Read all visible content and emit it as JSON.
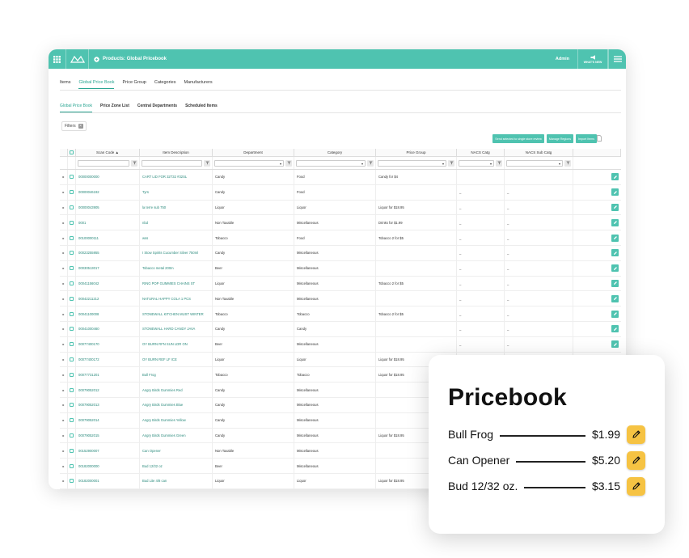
{
  "topbar": {
    "title": "Products: Global Pricebook",
    "admin": "Admin",
    "whatsnew": "WHAT'S NEW"
  },
  "tabs_primary": [
    "Items",
    "Global Price Book",
    "Price Group",
    "Categories",
    "Manufacturers"
  ],
  "tabs_secondary": [
    "Global Price Book",
    "Price Zone List",
    "Central Departments",
    "Scheduled Items"
  ],
  "filters_label": "Filters",
  "actions": [
    "Send selected to single store review",
    "Manage Regions",
    "Import Items"
  ],
  "columns": [
    "Scan Code",
    "Item Description",
    "Department",
    "Category",
    "Price Group",
    "NACS Catg",
    "NACS Sub Catg"
  ],
  "rows": [
    {
      "scan": "00000000000",
      "desc": "CART LID FOR 32T32 #32SL",
      "dept": "Candy",
      "cat": "Food",
      "pg": "Candy for $4",
      "nacs": "",
      "sub": ""
    },
    {
      "scan": "00000046192",
      "desc": "Tyrs",
      "dept": "Candy",
      "cat": "Food",
      "pg": "",
      "nacs": "_",
      "sub": "_"
    },
    {
      "scan": "00000043905",
      "desc": "la terre sub 750",
      "dept": "Liquor",
      "cat": "Liquor",
      "pg": "Liquor for $18.95",
      "nacs": "_",
      "sub": "_"
    },
    {
      "scan": "0001",
      "desc": "nbd",
      "dept": "Non Taxable",
      "cat": "Miscellaneous",
      "pg": "Drinks for $1.99",
      "nacs": "_",
      "sub": "_"
    },
    {
      "scan": "00100000111",
      "desc": "wss",
      "dept": "Tobacco",
      "cat": "Food",
      "pg": "Tobacco 2 for $5",
      "nacs": "_",
      "sub": "_"
    },
    {
      "scan": "00023255955",
      "desc": "I Stow Spirits Cucumber Silver 750ml",
      "dept": "Candy",
      "cat": "Miscellaneous",
      "pg": "",
      "nacs": "_",
      "sub": "_"
    },
    {
      "scan": "00030513017",
      "desc": "Tobacco metal 200m",
      "dept": "Beer",
      "cat": "Miscellaneous",
      "pg": "",
      "nacs": "_",
      "sub": "_"
    },
    {
      "scan": "00041156042",
      "desc": "RING POP GUMMIES CHAINS ST",
      "dept": "Liquor",
      "cat": "Miscellaneous",
      "pg": "Tobacco 2 for $5",
      "nacs": "_",
      "sub": "_"
    },
    {
      "scan": "00042211212",
      "desc": "NATURAL HAPPY COLA 1 PCS",
      "dept": "Non Taxable",
      "cat": "Miscellaneous",
      "pg": "",
      "nacs": "_",
      "sub": "_"
    },
    {
      "scan": "00041100008",
      "desc": "STONEWALL KITCHEN MUST WINTER",
      "dept": "Tobacco",
      "cat": "Tobacco",
      "pg": "Tobacco 2 for $5",
      "nacs": "_",
      "sub": "_"
    },
    {
      "scan": "00041000460",
      "desc": "STONEWALL HARD CANDY JAVA",
      "dept": "Candy",
      "cat": "Candy",
      "pg": "",
      "nacs": "_",
      "sub": "_"
    },
    {
      "scan": "00077400170",
      "desc": "OY BURN RFN SUN LDR ON",
      "dept": "Beer",
      "cat": "Miscellaneous",
      "pg": "",
      "nacs": "_",
      "sub": "_"
    },
    {
      "scan": "00077400172",
      "desc": "OY BURN REF LF ICE",
      "dept": "Liquor",
      "cat": "Liquor",
      "pg": "Liquor for $18.95",
      "nacs": "_",
      "sub": "_"
    },
    {
      "scan": "00077731201",
      "desc": "Bull Frog",
      "dept": "Tobacco",
      "cat": "Tobacco",
      "pg": "Liquor for $18.95",
      "nacs": "_",
      "sub": "_"
    },
    {
      "scan": "00079052012",
      "desc": "Angry Birds Gummies Red",
      "dept": "Candy",
      "cat": "Miscellaneous",
      "pg": "",
      "nacs": "_",
      "sub": "_"
    },
    {
      "scan": "00079052013",
      "desc": "Angry Birds Gummies Blue",
      "dept": "Candy",
      "cat": "Miscellaneous",
      "pg": "",
      "nacs": "_",
      "sub": "_"
    },
    {
      "scan": "00079052014",
      "desc": "Angry Birds Gummies Yellow",
      "dept": "Candy",
      "cat": "Miscellaneous",
      "pg": "",
      "nacs": "_",
      "sub": "_"
    },
    {
      "scan": "00079052015",
      "desc": "Angry Birds Gummies Green",
      "dept": "Candy",
      "cat": "Miscellaneous",
      "pg": "Liquor for $18.95",
      "nacs": "_",
      "sub": "_"
    },
    {
      "scan": "00152900007",
      "desc": "Can Opener",
      "dept": "Non Taxable",
      "cat": "Miscellaneous",
      "pg": "",
      "nacs": "_",
      "sub": "_"
    },
    {
      "scan": "00182000000",
      "desc": "Bud 12/32 oz",
      "dept": "Beer",
      "cat": "Miscellaneous",
      "pg": "",
      "nacs": "_",
      "sub": "_"
    },
    {
      "scan": "00182000001",
      "desc": "Bud Lite 4/8 can",
      "dept": "Liquor",
      "cat": "Liquor",
      "pg": "Liquor for $18.95",
      "nacs": "_",
      "sub": "_"
    }
  ],
  "pricebook": {
    "title": "Pricebook",
    "items": [
      {
        "name": "Bull Frog",
        "price": "$1.99"
      },
      {
        "name": "Can Opener",
        "price": "$5.20"
      },
      {
        "name": "Bud 12/32 oz.",
        "price": "$3.15"
      }
    ]
  },
  "colors": {
    "accent": "#4fc3b0",
    "edit_yellow": "#f6c343"
  }
}
